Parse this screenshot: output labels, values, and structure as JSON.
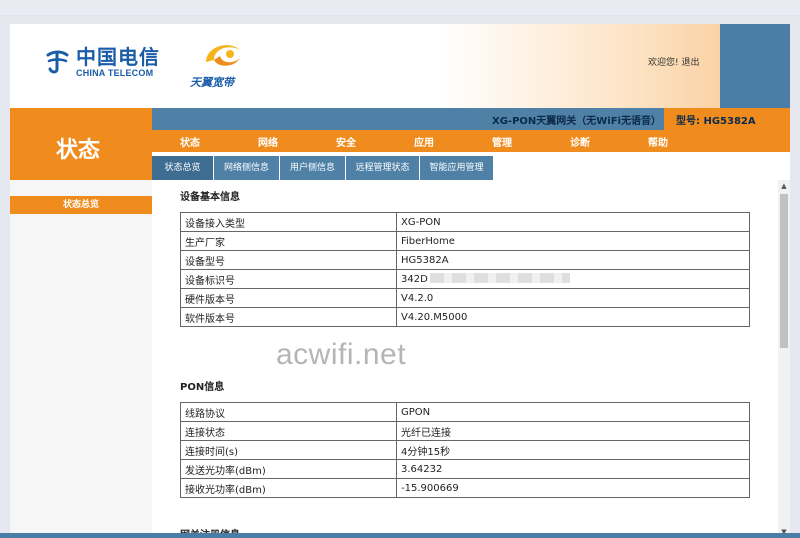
{
  "brand": {
    "ct_cn": "中国电信",
    "ct_en": "CHINA TELECOM",
    "tianyi": "天翼宽带"
  },
  "header": {
    "welcome": "欢迎您!",
    "logout": "退出"
  },
  "info_bar": {
    "device_title": "XG-PON天翼网关（无WiFi无语音）",
    "model_label": "型号: HG5382A"
  },
  "left_title": "状态",
  "menu": [
    {
      "label": "状态"
    },
    {
      "label": "网络"
    },
    {
      "label": "安全"
    },
    {
      "label": "应用"
    },
    {
      "label": "管理"
    },
    {
      "label": "诊断"
    },
    {
      "label": "帮助"
    }
  ],
  "subtabs": [
    {
      "label": "状态总览"
    },
    {
      "label": "网络侧信息"
    },
    {
      "label": "用户侧信息"
    },
    {
      "label": "远程管理状态"
    },
    {
      "label": "智能应用管理"
    }
  ],
  "sidebar": {
    "active_item": "状态总览"
  },
  "sections": [
    {
      "title": "设备基本信息",
      "rows": [
        {
          "key": "设备接入类型",
          "value": "XG-PON"
        },
        {
          "key": "生产厂家",
          "value": "FiberHome"
        },
        {
          "key": "设备型号",
          "value": "HG5382A"
        },
        {
          "key": "设备标识号",
          "value": "342D"
        },
        {
          "key": "硬件版本号",
          "value": "V4.2.0"
        },
        {
          "key": "软件版本号",
          "value": "V4.20.M5000"
        }
      ]
    },
    {
      "title": "PON信息",
      "rows": [
        {
          "key": "线路协议",
          "value": "GPON"
        },
        {
          "key": "连接状态",
          "value": "光纤已连接"
        },
        {
          "key": "连接时间(s)",
          "value": "4分钟15秒"
        },
        {
          "key": "发送光功率(dBm)",
          "value": "3.64232"
        },
        {
          "key": "接收光功率(dBm)",
          "value": "-15.900669"
        }
      ]
    },
    {
      "title": "网关注册信息",
      "rows": []
    }
  ],
  "watermark": "acwifi.net",
  "colors": {
    "orange": "#f08c1e",
    "blue": "#4f81a7",
    "brand_blue": "#1b5ca8"
  }
}
